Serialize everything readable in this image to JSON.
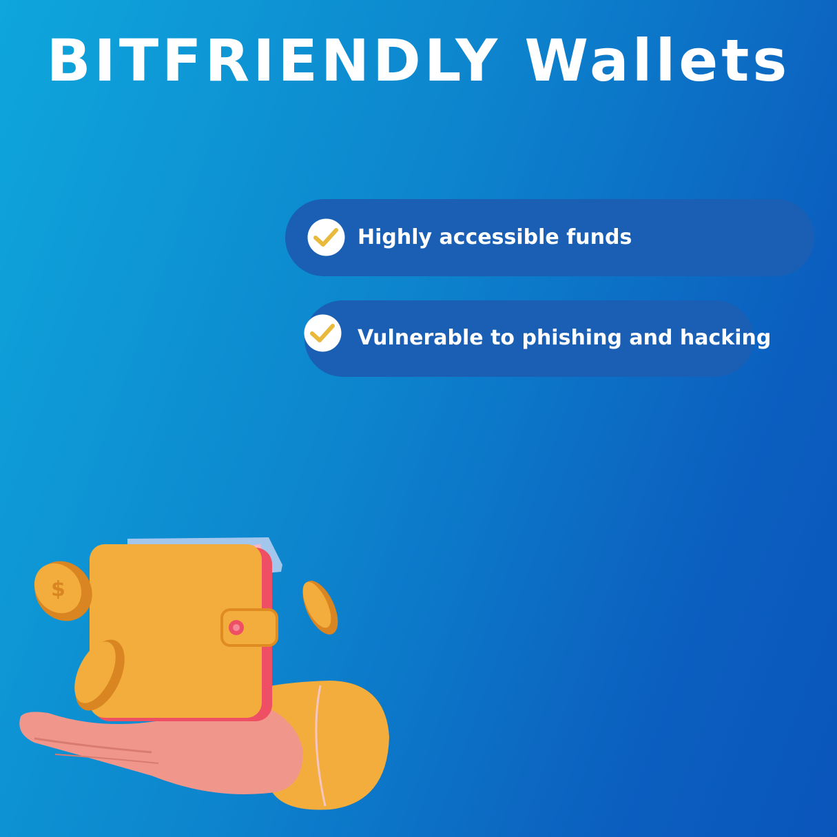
{
  "header": {
    "title": "BITFRIENDLY Wallets"
  },
  "features": [
    {
      "label": "Highly accessible funds",
      "icon": "check-circle-icon"
    },
    {
      "label": "Vulnerable to phishing and hacking",
      "icon": "check-circle-icon"
    }
  ],
  "illustration": {
    "icon": "hand-holding-wallet-icon"
  },
  "colors": {
    "background_start": "#0ea6dc",
    "background_end": "#0a55bb",
    "pill": "#1a5fb4",
    "check_mark": "#e8b93a",
    "text": "#ffffff"
  }
}
